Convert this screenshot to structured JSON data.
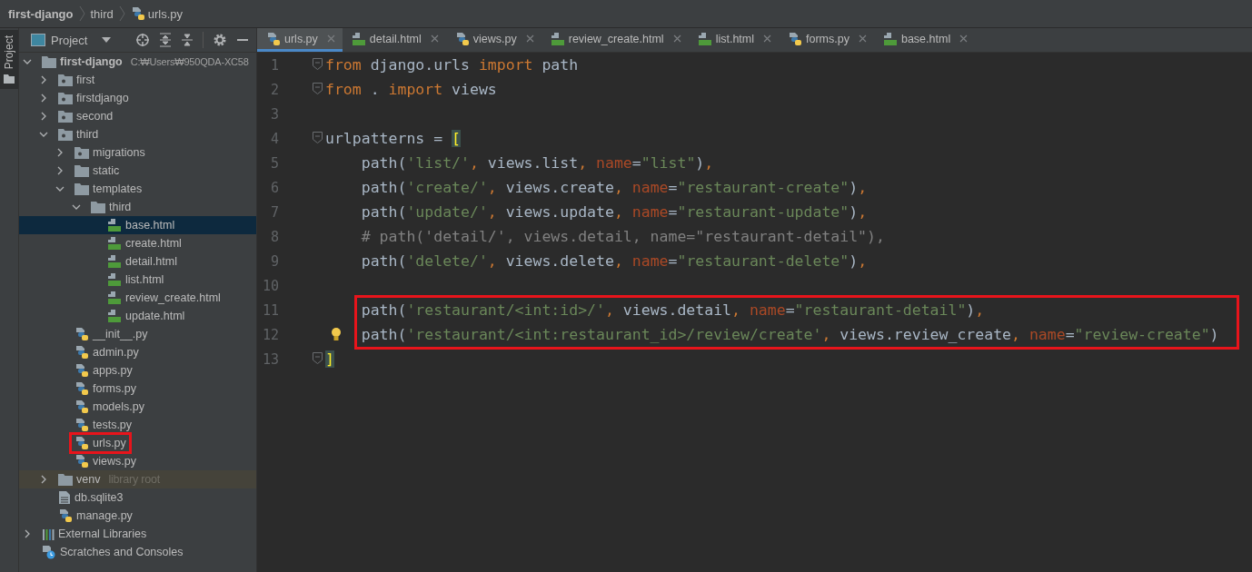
{
  "breadcrumb": [
    {
      "label": "first-django",
      "kind": "project"
    },
    {
      "label": "third",
      "kind": "folder"
    },
    {
      "label": "urls.py",
      "kind": "py"
    }
  ],
  "tool_strip": {
    "tab": {
      "label": "Project",
      "selected": true
    }
  },
  "project_panel": {
    "title": "Project",
    "tree": [
      {
        "name": "first-django",
        "kind": "project",
        "hint": "C:₩Users₩950QDA-XC58",
        "expanded": true,
        "selected": false,
        "children": [
          {
            "name": "first",
            "kind": "package",
            "expanded": false,
            "selected": false
          },
          {
            "name": "firstdjango",
            "kind": "package",
            "expanded": false,
            "selected": false
          },
          {
            "name": "second",
            "kind": "package",
            "expanded": false,
            "selected": false
          },
          {
            "name": "third",
            "kind": "package",
            "expanded": true,
            "selected": false,
            "children": [
              {
                "name": "migrations",
                "kind": "package",
                "expanded": false,
                "selected": false
              },
              {
                "name": "static",
                "kind": "folder",
                "expanded": false,
                "selected": false
              },
              {
                "name": "templates",
                "kind": "folder",
                "expanded": true,
                "selected": false,
                "children": [
                  {
                    "name": "third",
                    "kind": "folder",
                    "expanded": true,
                    "selected": false,
                    "children": [
                      {
                        "name": "base.html",
                        "kind": "html",
                        "selected": true
                      },
                      {
                        "name": "create.html",
                        "kind": "html",
                        "selected": false
                      },
                      {
                        "name": "detail.html",
                        "kind": "html",
                        "selected": false
                      },
                      {
                        "name": "list.html",
                        "kind": "html",
                        "selected": false
                      },
                      {
                        "name": "review_create.html",
                        "kind": "html",
                        "selected": false
                      },
                      {
                        "name": "update.html",
                        "kind": "html",
                        "selected": false
                      }
                    ]
                  }
                ]
              },
              {
                "name": "__init__.py",
                "kind": "py",
                "selected": false
              },
              {
                "name": "admin.py",
                "kind": "py",
                "selected": false
              },
              {
                "name": "apps.py",
                "kind": "py",
                "selected": false
              },
              {
                "name": "forms.py",
                "kind": "py",
                "selected": false
              },
              {
                "name": "models.py",
                "kind": "py",
                "selected": false
              },
              {
                "name": "tests.py",
                "kind": "py",
                "selected": false
              },
              {
                "name": "urls.py",
                "kind": "py",
                "selected": false,
                "marked": true
              },
              {
                "name": "views.py",
                "kind": "py",
                "selected": false
              }
            ]
          },
          {
            "name": "venv",
            "kind": "library",
            "hint": "library root",
            "expanded": false,
            "selected": false
          },
          {
            "name": "db.sqlite3",
            "kind": "file",
            "selected": false
          },
          {
            "name": "manage.py",
            "kind": "py",
            "selected": false
          }
        ]
      },
      {
        "name": "External Libraries",
        "kind": "libraries",
        "expanded": false,
        "selected": false
      },
      {
        "name": "Scratches and Consoles",
        "kind": "scratches",
        "selected": false
      }
    ]
  },
  "tabs": [
    {
      "label": "urls.py",
      "kind": "py",
      "selected": true
    },
    {
      "label": "detail.html",
      "kind": "html",
      "selected": false
    },
    {
      "label": "views.py",
      "kind": "py",
      "selected": false
    },
    {
      "label": "review_create.html",
      "kind": "html",
      "selected": false
    },
    {
      "label": "list.html",
      "kind": "html",
      "selected": false
    },
    {
      "label": "forms.py",
      "kind": "py",
      "selected": false
    },
    {
      "label": "base.html",
      "kind": "html",
      "selected": false
    }
  ],
  "code": {
    "blocks": [
      {
        "boxed": false,
        "lines": [
          {
            "number": "1",
            "fold": true,
            "tokens": [
              {
                "kind": "kw",
                "text": "from "
              },
              {
                "kind": "text",
                "text": "django.urls "
              },
              {
                "kind": "kw",
                "text": "import "
              },
              {
                "kind": "text",
                "text": "path"
              }
            ]
          },
          {
            "number": "2",
            "fold": true,
            "tokens": [
              {
                "kind": "kw",
                "text": "from "
              },
              {
                "kind": "text",
                "text": ". "
              },
              {
                "kind": "kw",
                "text": "import "
              },
              {
                "kind": "text",
                "text": "views"
              }
            ]
          },
          {
            "number": "3",
            "fold": false
          },
          {
            "number": "4",
            "fold": true,
            "tokens": [
              {
                "kind": "text",
                "text": "urlpatterns = "
              },
              {
                "kind": "match",
                "text": "["
              }
            ]
          },
          {
            "number": "5",
            "fold": false,
            "tokens": [
              {
                "kind": "text",
                "text": "    path("
              },
              {
                "kind": "str",
                "text": "'list/'"
              },
              {
                "kind": "kw",
                "text": ", "
              },
              {
                "kind": "text",
                "text": "views.list"
              },
              {
                "kind": "kw",
                "text": ", "
              },
              {
                "kind": "param",
                "text": "name"
              },
              {
                "kind": "text",
                "text": "="
              },
              {
                "kind": "str",
                "text": "\"list\""
              },
              {
                "kind": "text",
                "text": ")"
              },
              {
                "kind": "kw",
                "text": ","
              }
            ]
          },
          {
            "number": "6",
            "fold": false,
            "tokens": [
              {
                "kind": "text",
                "text": "    path("
              },
              {
                "kind": "str",
                "text": "'create/'"
              },
              {
                "kind": "kw",
                "text": ", "
              },
              {
                "kind": "text",
                "text": "views.create"
              },
              {
                "kind": "kw",
                "text": ", "
              },
              {
                "kind": "param",
                "text": "name"
              },
              {
                "kind": "text",
                "text": "="
              },
              {
                "kind": "str",
                "text": "\"restaurant-create\""
              },
              {
                "kind": "text",
                "text": ")"
              },
              {
                "kind": "kw",
                "text": ","
              }
            ]
          },
          {
            "number": "7",
            "fold": false,
            "tokens": [
              {
                "kind": "text",
                "text": "    path("
              },
              {
                "kind": "str",
                "text": "'update/'"
              },
              {
                "kind": "kw",
                "text": ", "
              },
              {
                "kind": "text",
                "text": "views.update"
              },
              {
                "kind": "kw",
                "text": ", "
              },
              {
                "kind": "param",
                "text": "name"
              },
              {
                "kind": "text",
                "text": "="
              },
              {
                "kind": "str",
                "text": "\"restaurant-update\""
              },
              {
                "kind": "text",
                "text": ")"
              },
              {
                "kind": "kw",
                "text": ","
              }
            ]
          },
          {
            "number": "8",
            "fold": false,
            "tokens": [
              {
                "kind": "comment",
                "text": "    # path('detail/', views.detail, name=\"restaurant-detail\"),"
              }
            ]
          },
          {
            "number": "9",
            "fold": false,
            "tokens": [
              {
                "kind": "text",
                "text": "    path("
              },
              {
                "kind": "str",
                "text": "'delete/'"
              },
              {
                "kind": "kw",
                "text": ", "
              },
              {
                "kind": "text",
                "text": "views.delete"
              },
              {
                "kind": "kw",
                "text": ", "
              },
              {
                "kind": "param",
                "text": "name"
              },
              {
                "kind": "text",
                "text": "="
              },
              {
                "kind": "str",
                "text": "\"restaurant-delete\""
              },
              {
                "kind": "text",
                "text": ")"
              },
              {
                "kind": "kw",
                "text": ","
              }
            ]
          },
          {
            "number": "10",
            "fold": false
          }
        ]
      },
      {
        "boxed": true,
        "lines": [
          {
            "number": "11",
            "fold": false,
            "tokens": [
              {
                "kind": "text",
                "text": "path("
              },
              {
                "kind": "str",
                "text": "'restaurant/<int:id>/'"
              },
              {
                "kind": "kw",
                "text": ", "
              },
              {
                "kind": "text",
                "text": "views.detail"
              },
              {
                "kind": "kw",
                "text": ", "
              },
              {
                "kind": "param",
                "text": "name"
              },
              {
                "kind": "text",
                "text": "="
              },
              {
                "kind": "str",
                "text": "\"restaurant-detail\""
              },
              {
                "kind": "text",
                "text": ")"
              },
              {
                "kind": "kw",
                "text": ","
              }
            ]
          },
          {
            "number": "12",
            "fold": false,
            "bulb": true,
            "tokens": [
              {
                "kind": "text",
                "text": "path("
              },
              {
                "kind": "str",
                "text": "'restaurant/<int:restaurant_id>/review/create'"
              },
              {
                "kind": "kw",
                "text": ", "
              },
              {
                "kind": "text",
                "text": "views.review_create"
              },
              {
                "kind": "kw",
                "text": ", "
              },
              {
                "kind": "param",
                "text": "name"
              },
              {
                "kind": "text",
                "text": "="
              },
              {
                "kind": "str",
                "text": "\"review-create\""
              },
              {
                "kind": "text",
                "text": ")"
              }
            ]
          }
        ]
      },
      {
        "boxed": false,
        "lines": [
          {
            "number": "13",
            "fold": true,
            "tokens": [
              {
                "kind": "match",
                "text": "]"
              }
            ]
          }
        ]
      }
    ]
  }
}
